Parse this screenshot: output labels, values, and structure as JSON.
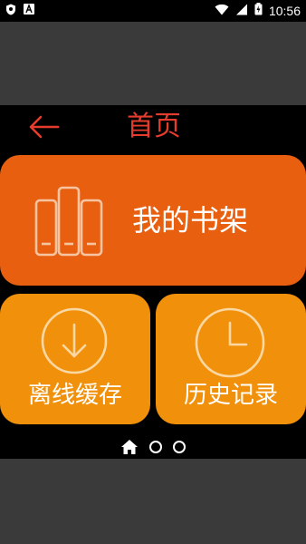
{
  "status_bar": {
    "time": "10:56",
    "left_icons": [
      "shield-icon",
      "font-a-icon"
    ],
    "right_icons": [
      "wifi-icon",
      "signal-icon",
      "battery-charging-icon"
    ]
  },
  "header": {
    "title": "首页",
    "back_icon": "arrow-left-icon"
  },
  "cards": {
    "bookshelf": {
      "label": "我的书架",
      "icon": "books-icon"
    },
    "offline": {
      "label": "离线缓存",
      "icon": "download-circle-icon"
    },
    "history": {
      "label": "历史记录",
      "icon": "clock-icon"
    }
  },
  "pager": {
    "pages": 3,
    "current_page": 1,
    "current_icon": "home-icon"
  },
  "colors": {
    "title": "#e53c2e",
    "bookshelf_bg": "#e75f0f",
    "small_card_bg": "#f1900b",
    "app_bg": "#000000",
    "outer_bg": "#3a3a3a"
  }
}
